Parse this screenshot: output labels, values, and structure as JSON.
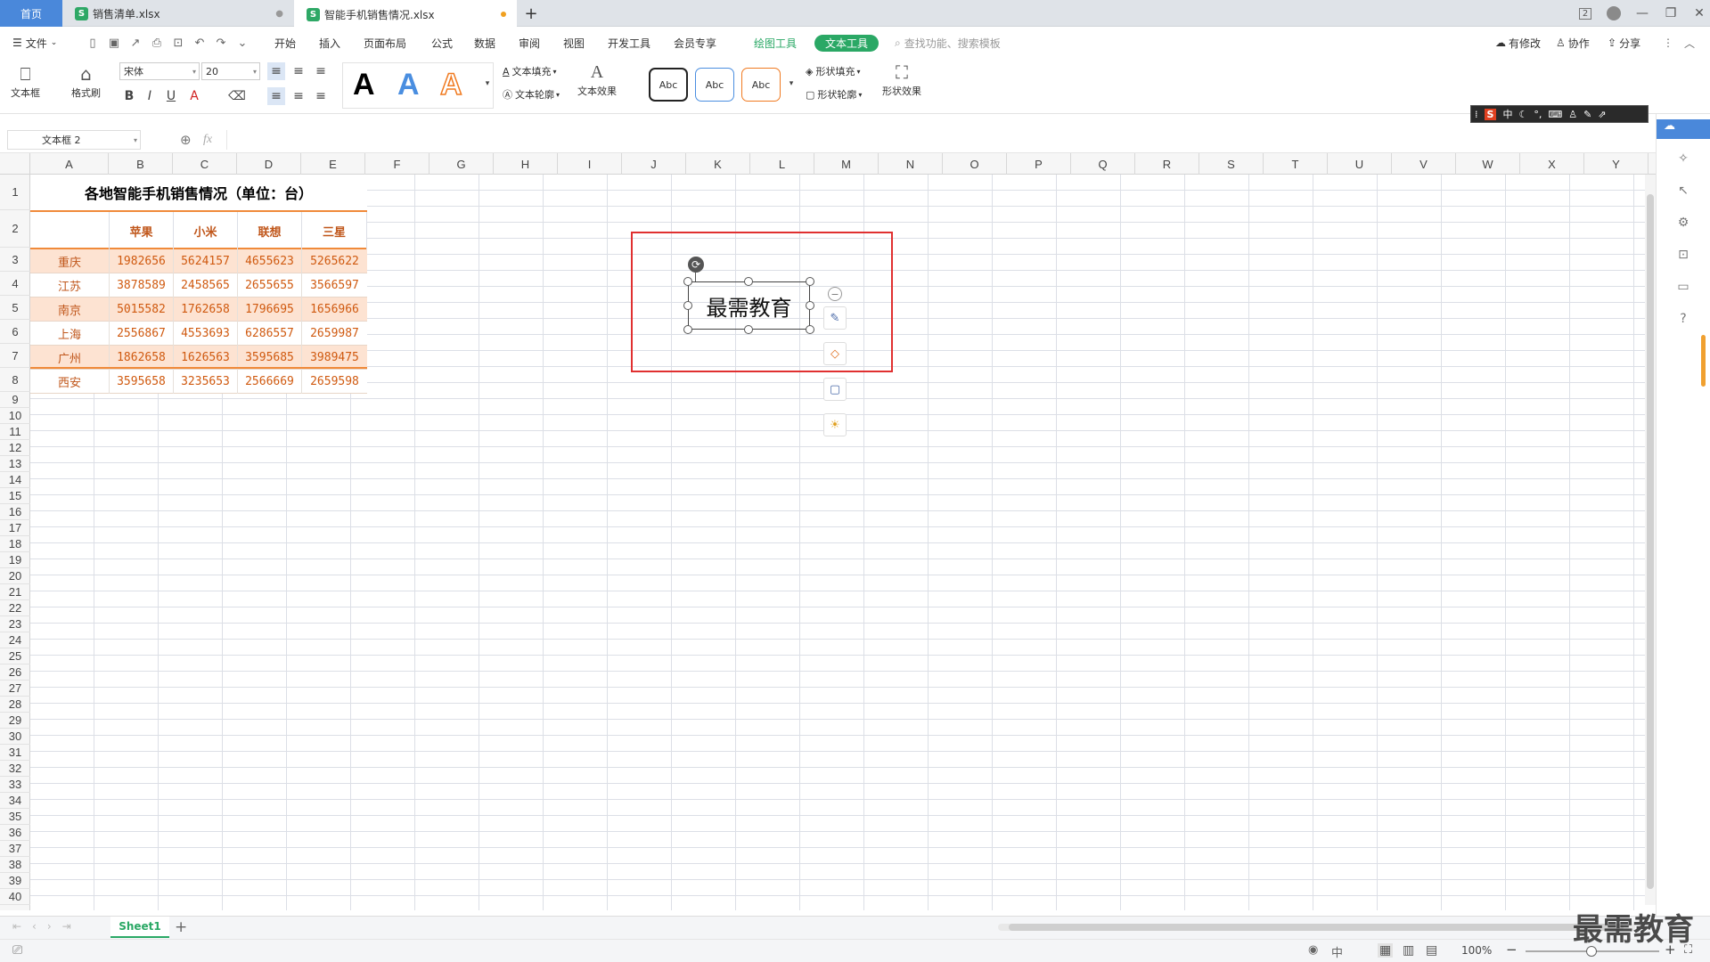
{
  "tabs": {
    "home": "首页",
    "doc1": {
      "icon": "S",
      "label": "销售清单.xlsx"
    },
    "doc2": {
      "icon": "S",
      "label": "智能手机销售情况.xlsx"
    },
    "new_tab": "+"
  },
  "window": {
    "badge": "2"
  },
  "menu": {
    "file": "文件",
    "items": [
      "开始",
      "插入",
      "页面布局",
      "公式",
      "数据",
      "审阅",
      "视图",
      "开发工具",
      "会员专享"
    ],
    "drawing_tool": "绘图工具",
    "text_tool": "文本工具",
    "search_placeholder": "查找功能、搜索模板",
    "changes": "有修改",
    "collab": "协作",
    "share": "分享"
  },
  "ribbon": {
    "textbox_label": "文本框",
    "format_painter_label": "格式刷",
    "font_name": "宋体",
    "font_size": "20",
    "style_letter": "A",
    "text_fill": "文本填充",
    "text_outline": "文本轮廓",
    "text_effect": "文本效果",
    "abc_label": "Abc",
    "shape_fill": "形状填充",
    "shape_outline": "形状轮廓",
    "shape_effect": "形状效果"
  },
  "ime": {
    "lang": "中"
  },
  "formula_bar": {
    "name_box": "文本框 2",
    "fx": "fx",
    "formula": ""
  },
  "columns": [
    "A",
    "B",
    "C",
    "D",
    "E",
    "F",
    "G",
    "H",
    "I",
    "J",
    "K",
    "L",
    "M",
    "N",
    "O",
    "P",
    "Q",
    "R",
    "S",
    "T",
    "U",
    "V",
    "W",
    "X",
    "Y"
  ],
  "rows": [
    "1",
    "2",
    "3",
    "4",
    "5",
    "6",
    "7",
    "8",
    "9",
    "10",
    "11",
    "12",
    "13",
    "14",
    "15",
    "16",
    "17",
    "18",
    "19",
    "20",
    "21",
    "22",
    "23",
    "24",
    "25",
    "26",
    "27",
    "28",
    "29",
    "30",
    "31",
    "32",
    "33",
    "34",
    "35",
    "36",
    "37",
    "38",
    "39",
    "40"
  ],
  "table": {
    "title": "各地智能手机销售情况（单位：台）",
    "headers": [
      "苹果",
      "小米",
      "联想",
      "三星"
    ],
    "rows": [
      {
        "city": "重庆",
        "values": [
          "1982656",
          "5624157",
          "4655623",
          "5265622"
        ]
      },
      {
        "city": "江苏",
        "values": [
          "3878589",
          "2458565",
          "2655655",
          "3566597"
        ]
      },
      {
        "city": "南京",
        "values": [
          "5015582",
          "1762658",
          "1796695",
          "1656966"
        ]
      },
      {
        "city": "上海",
        "values": [
          "2556867",
          "4553693",
          "6286557",
          "2659987"
        ]
      },
      {
        "city": "广州",
        "values": [
          "1862658",
          "1626563",
          "3595685",
          "3989475"
        ]
      },
      {
        "city": "西安",
        "values": [
          "3595658",
          "3235653",
          "2566669",
          "2659598"
        ]
      }
    ]
  },
  "textbox": {
    "content": "最需教育"
  },
  "colors": {
    "highlight_box": "#e03030",
    "accent_green": "#2aa865",
    "table_text": "#d05a10",
    "row_band": "#fde3d2"
  },
  "sheets": {
    "active": "Sheet1",
    "add": "+"
  },
  "status": {
    "zoom": "100%"
  },
  "watermark": "最需教育"
}
